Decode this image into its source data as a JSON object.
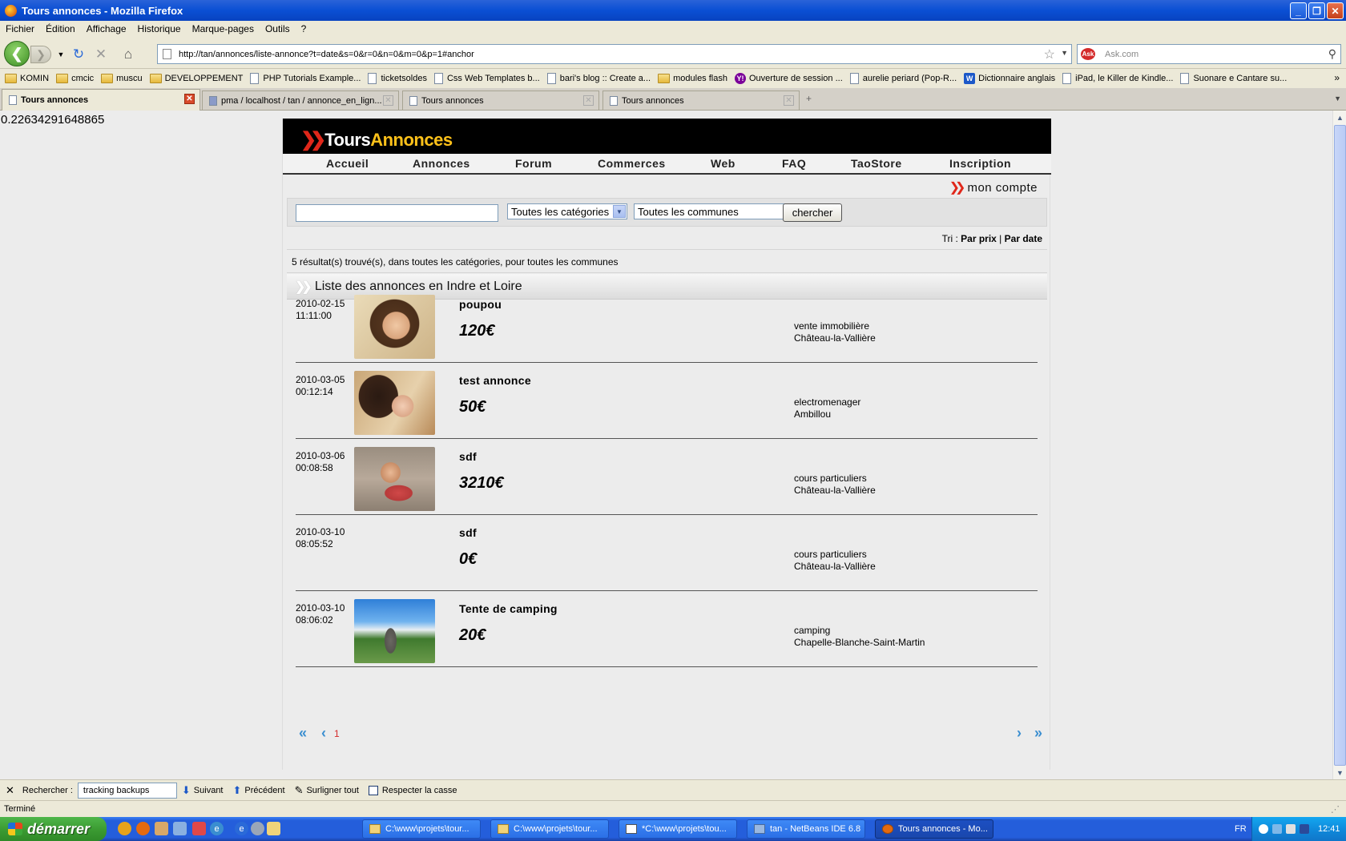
{
  "window": {
    "title": "Tours annonces - Mozilla Firefox"
  },
  "menu": [
    "Fichier",
    "Édition",
    "Affichage",
    "Historique",
    "Marque-pages",
    "Outils",
    "?"
  ],
  "nav": {
    "url": "http://tan/annonces/liste-annonce?t=date&s=0&r=0&n=0&m=0&p=1#anchor",
    "search_placeholder": "Ask.com"
  },
  "bookmarks": [
    "KOMIN",
    "cmcic",
    "muscu",
    "DEVELOPPEMENT",
    "PHP Tutorials Example...",
    "ticketsoldes",
    "Css Web Templates b...",
    "bari's blog :: Create a...",
    "modules flash",
    "Ouverture de session ...",
    "aurelie periard (Pop-R...",
    "Dictionnaire anglais",
    "iPad, le Killer de Kindle...",
    "Suonare e Cantare su..."
  ],
  "tabs": [
    "Tours annonces",
    "pma / localhost / tan / annonce_en_lign...",
    "Tours annonces",
    "Tours annonces"
  ],
  "debug_number": "0.22634291648865",
  "site": {
    "logo_a": "Tours",
    "logo_b": "Annonces",
    "nav": [
      "Accueil",
      "Annonces",
      "Forum",
      "Commerces",
      "Web",
      "FAQ",
      "TaoStore",
      "Inscription"
    ],
    "account": "mon compte",
    "search": {
      "keyword": "",
      "category": "Toutes les catégories",
      "commune": "Toutes les communes",
      "button": "chercher"
    },
    "sort": {
      "label": "Tri : ",
      "by_price": "Par prix",
      "sep": " | ",
      "by_date": "Par date"
    },
    "result_count": "5 résultat(s) trouvé(s), dans toutes les catégories, pour toutes les communes",
    "list_title": "Liste des annonces en Indre et Loire",
    "listings": [
      {
        "date": "2010-02-15",
        "time": "11:11:00",
        "title": "poupou",
        "price": "120€",
        "category": "vente immobilière",
        "commune": "Château-la-Vallière",
        "has_photo": true
      },
      {
        "date": "2010-03-05",
        "time": "00:12:14",
        "title": "test annonce",
        "price": "50€",
        "category": "electromenager",
        "commune": "Ambillou",
        "has_photo": true
      },
      {
        "date": "2010-03-06",
        "time": "00:08:58",
        "title": "sdf",
        "price": "3210€",
        "category": "cours particuliers",
        "commune": "Château-la-Vallière",
        "has_photo": true
      },
      {
        "date": "2010-03-10",
        "time": "08:05:52",
        "title": "sdf",
        "price": "0€",
        "category": "cours particuliers",
        "commune": "Château-la-Vallière",
        "has_photo": false
      },
      {
        "date": "2010-03-10",
        "time": "08:06:02",
        "title": "Tente de camping",
        "price": "20€",
        "category": "camping",
        "commune": "Chapelle-Blanche-Saint-Martin",
        "has_photo": true
      }
    ],
    "pager": {
      "first": "«",
      "prev": "‹",
      "page": "1",
      "next": "›",
      "last": "»"
    }
  },
  "findbar": {
    "label": "Rechercher :",
    "value": "tracking backups",
    "next": "Suivant",
    "prev": "Précédent",
    "highlight": "Surligner tout",
    "match_case": "Respecter la casse"
  },
  "status": "Terminé",
  "taskbar": {
    "start": "démarrer",
    "tasks": [
      "C:\\www\\projets\\tour...",
      "C:\\www\\projets\\tour...",
      "*C:\\www\\projets\\tou...",
      "tan - NetBeans IDE 6.8",
      "Tours annonces - Mo..."
    ],
    "lang": "FR",
    "clock": "12:41"
  },
  "colors": {
    "logo_yellow": "#ffc21a",
    "accent_red": "#e0271a",
    "pager_blue": "#3a8ed0"
  }
}
